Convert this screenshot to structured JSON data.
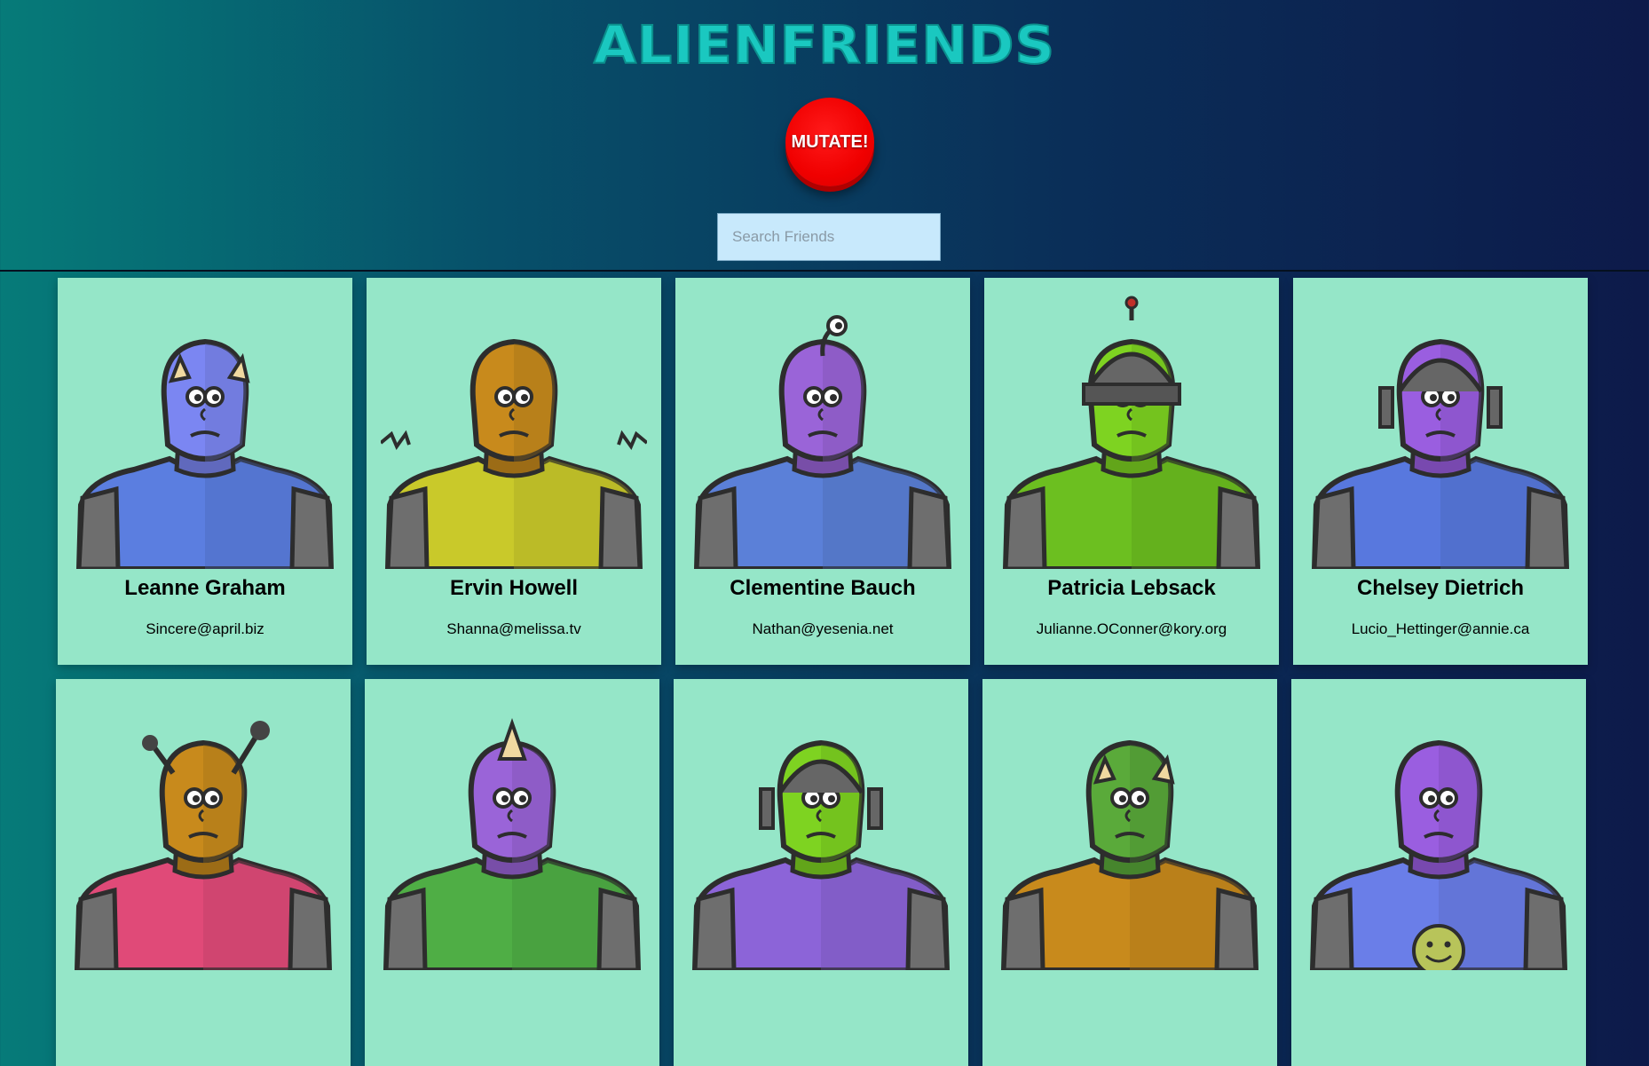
{
  "app": {
    "logo_text": "ALIENFRIENDS",
    "mutate_label": "MUTATE!",
    "search_placeholder": "Search Friends",
    "colors": {
      "card": "#95e6c8",
      "logo": "#1ac8c0",
      "button": "#f00000"
    }
  },
  "friends": [
    {
      "name": "Leanne Graham",
      "email": "Sincere@april.biz",
      "skin": "#7b86f2",
      "body": "#5b7ee0",
      "feature": "horns"
    },
    {
      "name": "Ervin Howell",
      "email": "Shanna@melissa.tv",
      "skin": "#c88a1c",
      "body": "#c9c92a",
      "feature": "spikes"
    },
    {
      "name": "Clementine Bauch",
      "email": "Nathan@yesenia.net",
      "skin": "#9a64d8",
      "body": "#5b80d8",
      "feature": "antenna-eye"
    },
    {
      "name": "Patricia Lebsack",
      "email": "Julianne.OConner@kory.org",
      "skin": "#7ed321",
      "body": "#6cbf20",
      "feature": "helmet"
    },
    {
      "name": "Chelsey Dietrich",
      "email": "Lucio_Hettinger@annie.ca",
      "skin": "#9a5ee0",
      "body": "#5878de",
      "feature": "visor"
    },
    {
      "name": "",
      "email": "",
      "skin": "#c88a1c",
      "body": "#e04a78",
      "feature": "antennae"
    },
    {
      "name": "",
      "email": "",
      "skin": "#9a64d8",
      "body": "#4fae45",
      "feature": "horn"
    },
    {
      "name": "",
      "email": "",
      "skin": "#7ed321",
      "body": "#8c64d8",
      "feature": "visor"
    },
    {
      "name": "",
      "email": "",
      "skin": "#5aaa3a",
      "body": "#c88a1c",
      "feature": "horns"
    },
    {
      "name": "",
      "email": "",
      "skin": "#9a5ee0",
      "body": "#6a7ee8",
      "feature": "smiley"
    }
  ]
}
